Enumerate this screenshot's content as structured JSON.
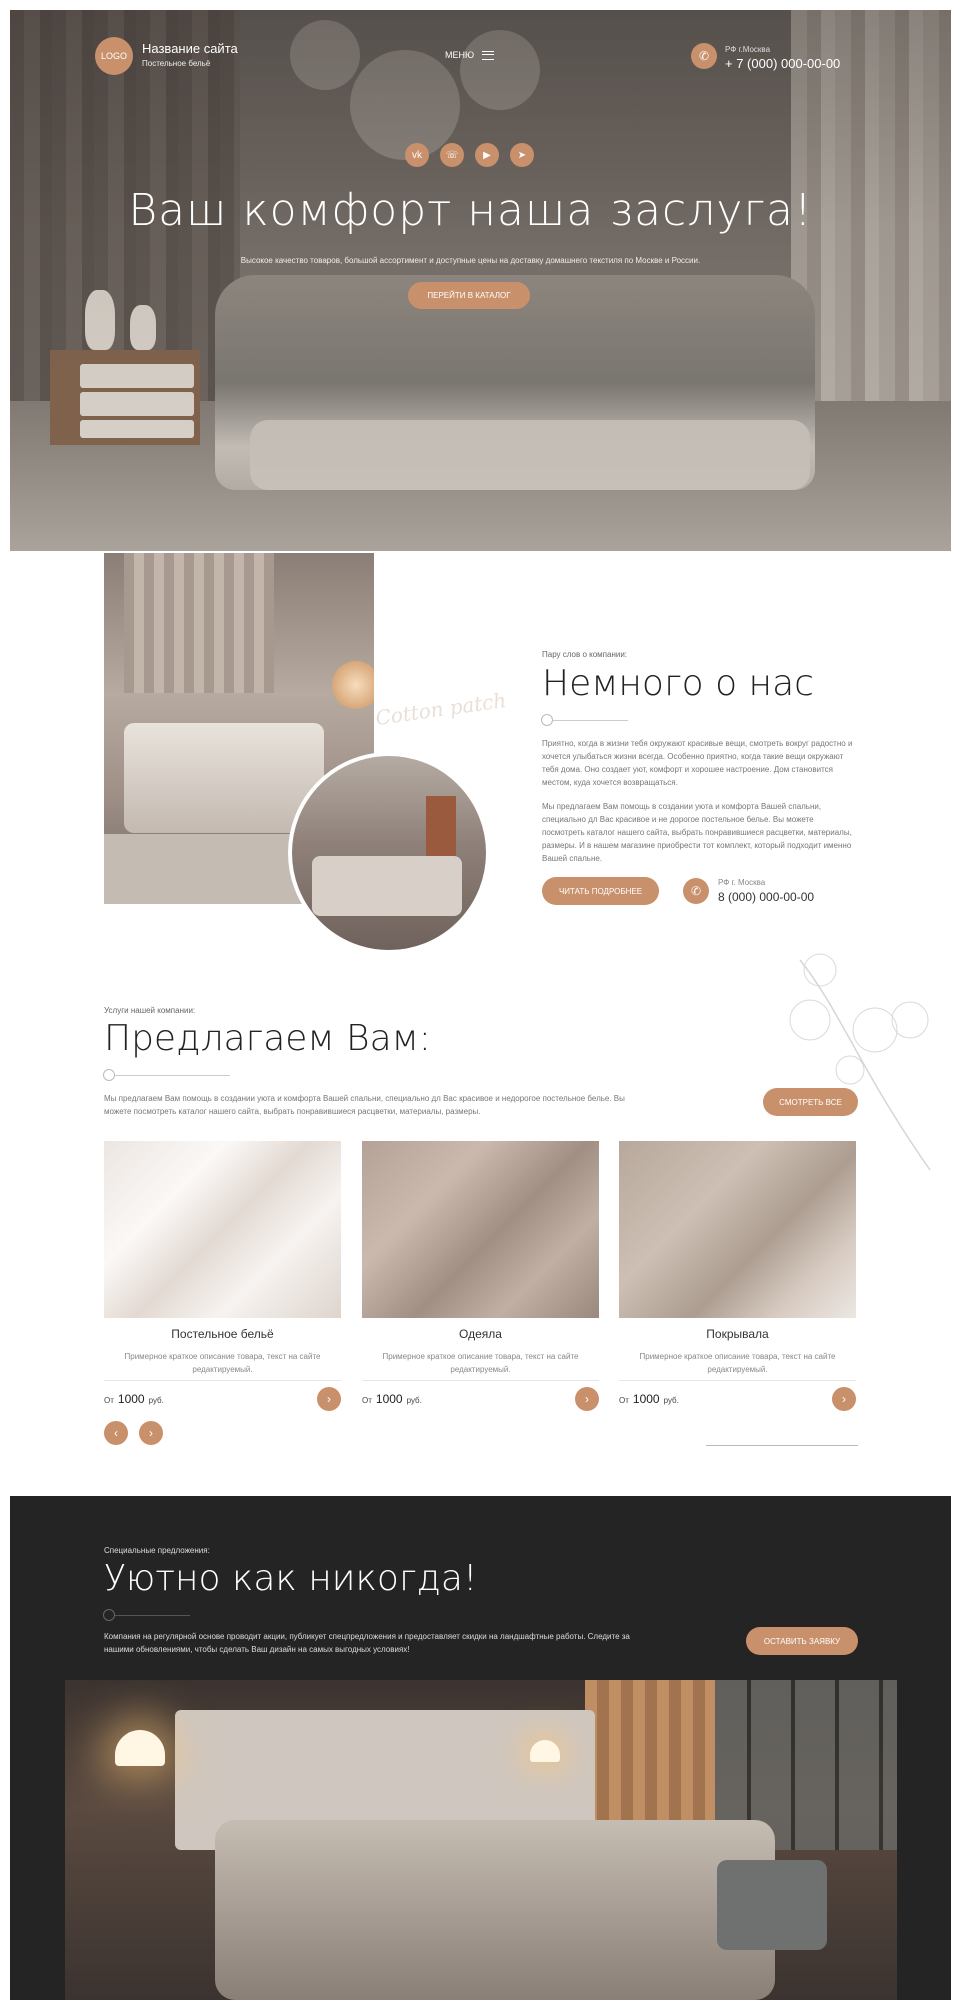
{
  "header": {
    "logo": "LOGO",
    "site_name": "Название сайта",
    "site_sub": "Постельное бельё",
    "menu_label": "МЕНЮ",
    "city": "РФ г.Москва",
    "phone": "+ 7 (000) 000-00-00"
  },
  "hero": {
    "socials": [
      "vk",
      "whatsapp",
      "youtube",
      "telegram"
    ],
    "title": "Ваш комфорт наша заслуга!",
    "desc": "Высокое качество товаров, большой ассортимент и доступные цены на доставку домашнего текстиля по Москве и России.",
    "button": "ПЕРЕЙТИ В КАТАЛОГ"
  },
  "about": {
    "pre": "Пару слов о компании:",
    "title": "Немного о нас",
    "p1": "Приятно, когда в жизни тебя окружают красивые вещи, смотреть вокруг радостно и хочется улыбаться жизни всегда. Особенно приятно, когда такие вещи окружают тебя дома. Оно создает уют, комфорт и хорошее настроение. Дом становится местом, куда хочется возвращаться.",
    "p2": "Мы предлагаем Вам помощь в создании уюта и комфорта Вашей спальни, специально дл Вас красивое и не дорогое постельное белье. Вы можете посмотреть каталог нашего сайта, выбрать понравившиеся расцветки, материалы, размеры. И в нашем магазине приобрести тот комплект, который подходит именно Вашей спальне.",
    "button": "ЧИТАТЬ ПОДРОБНЕЕ",
    "city": "РФ г. Москва",
    "phone": "8 (000) 000-00-00",
    "decor_text": "Cotton patch"
  },
  "services": {
    "pre": "Услуги нашей компании:",
    "title": "Предлагаем Вам:",
    "desc": "Мы предлагаем Вам помощь в создании уюта и комфорта Вашей спальни, специально дл Вас красивое и недорогое постельное белье. Вы можете посмотреть каталог нашего сайта, выбрать понравившиеся расцветки, материалы, размеры.",
    "button": "СМОТРЕТЬ ВСЕ",
    "cards": [
      {
        "title": "Постельное бельё",
        "desc": "Примерное краткое описание товара, текст на сайте редактируемый.",
        "price_from": "От",
        "price": "1000",
        "currency": "руб."
      },
      {
        "title": "Одеяла",
        "desc": "Примерное краткое описание товара, текст на сайте редактируемый.",
        "price_from": "От",
        "price": "1000",
        "currency": "руб."
      },
      {
        "title": "Покрывала",
        "desc": "Примерное краткое описание товара, текст на сайте редактируемый.",
        "price_from": "От",
        "price": "1000",
        "currency": "руб."
      }
    ]
  },
  "special": {
    "pre": "Специальные предложения:",
    "title": "Уютно как никогда!",
    "desc": "Компания на регулярной основе проводит акции, публикует спецпредложения и предоставляет скидки на ландшафтные работы. Следите за нашими обновлениями, чтобы сделать Ваш  дизайн на самых выгодных условиях!",
    "button": "ОСТАВИТЬ ЗАЯВКУ"
  },
  "colors": {
    "accent": "#c9906c",
    "dark": "#252424"
  }
}
